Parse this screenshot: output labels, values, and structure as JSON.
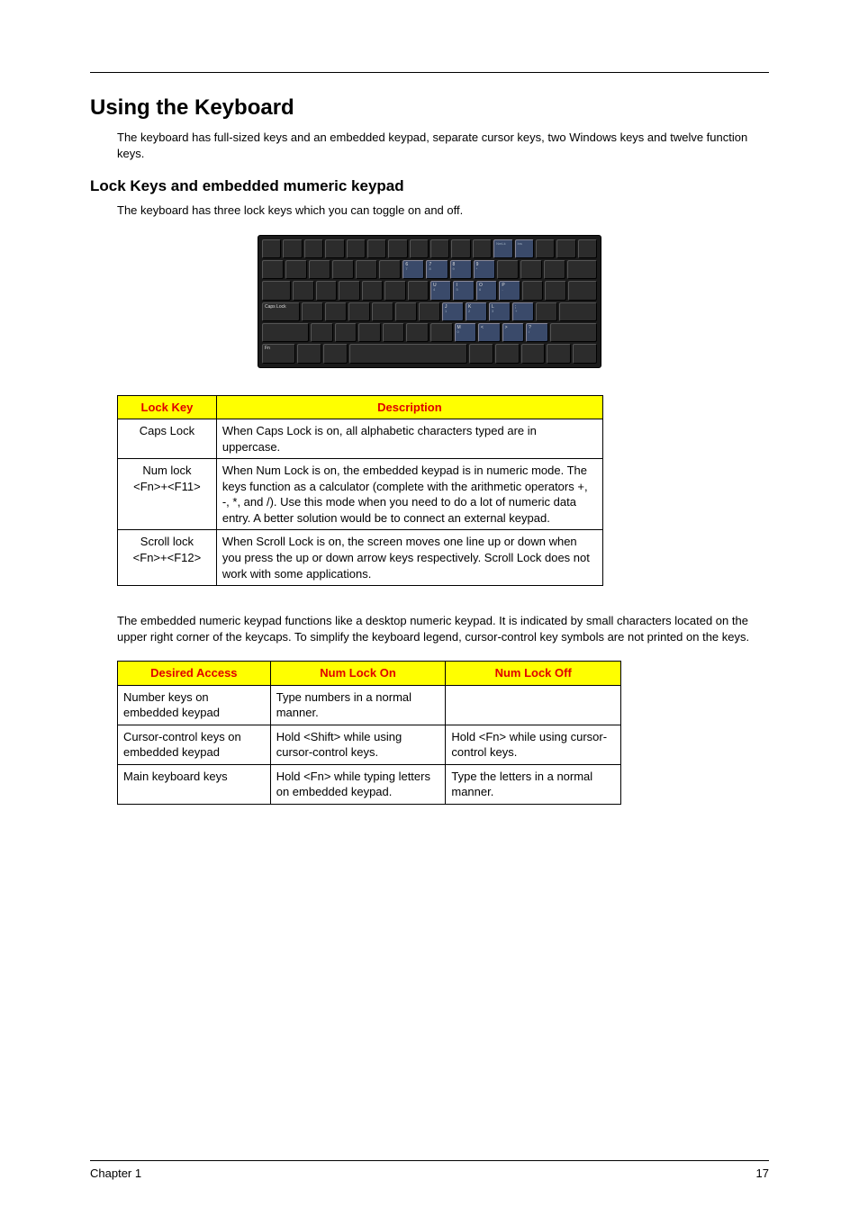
{
  "heading": "Using the Keyboard",
  "intro": "The keyboard has full-sized keys and an embedded keypad, separate cursor keys, two Windows keys and twelve function keys.",
  "subheading": "Lock Keys and embedded mumeric keypad",
  "sub_intro": "The keyboard has three lock keys which you can toggle on and off.",
  "kb_label_caps": "Caps Lock",
  "table1": {
    "headers": [
      "Lock Key",
      "Description"
    ],
    "rows": [
      {
        "key": "Caps Lock",
        "desc": "When Caps Lock is on, all alphabetic characters typed are in uppercase."
      },
      {
        "key": "Num lock\n<Fn>+<F11>",
        "desc": "When Num Lock is on, the embedded keypad is in numeric mode. The keys function as a calculator (complete with the arithmetic operators +, -, *, and /). Use this mode when you need to do a lot of numeric data entry. A better solution would be to connect an external keypad."
      },
      {
        "key": "Scroll lock\n<Fn>+<F12>",
        "desc": "When Scroll Lock is on, the screen moves one line up or down when you press the up or down arrow keys respectively. Scroll Lock does not work with some applications."
      }
    ]
  },
  "mid_para": "The embedded numeric keypad functions like a desktop numeric keypad. It is indicated by small characters located on the upper right corner of the keycaps. To simplify the keyboard legend, cursor-control key symbols are not printed on the keys.",
  "table2": {
    "headers": [
      "Desired Access",
      "Num Lock On",
      "Num Lock Off"
    ],
    "rows": [
      {
        "a": "Number keys on embedded keypad",
        "b": "Type numbers in a normal manner.",
        "c": ""
      },
      {
        "a": "Cursor-control keys on embedded keypad",
        "b": "Hold <Shift> while using cursor-control keys.",
        "c": "Hold <Fn> while using cursor-control keys."
      },
      {
        "a": "Main keyboard keys",
        "b": "Hold <Fn> while typing letters on embedded keypad.",
        "c": "Type the letters in a normal manner."
      }
    ]
  },
  "footer_left": "Chapter 1",
  "footer_right": "17"
}
